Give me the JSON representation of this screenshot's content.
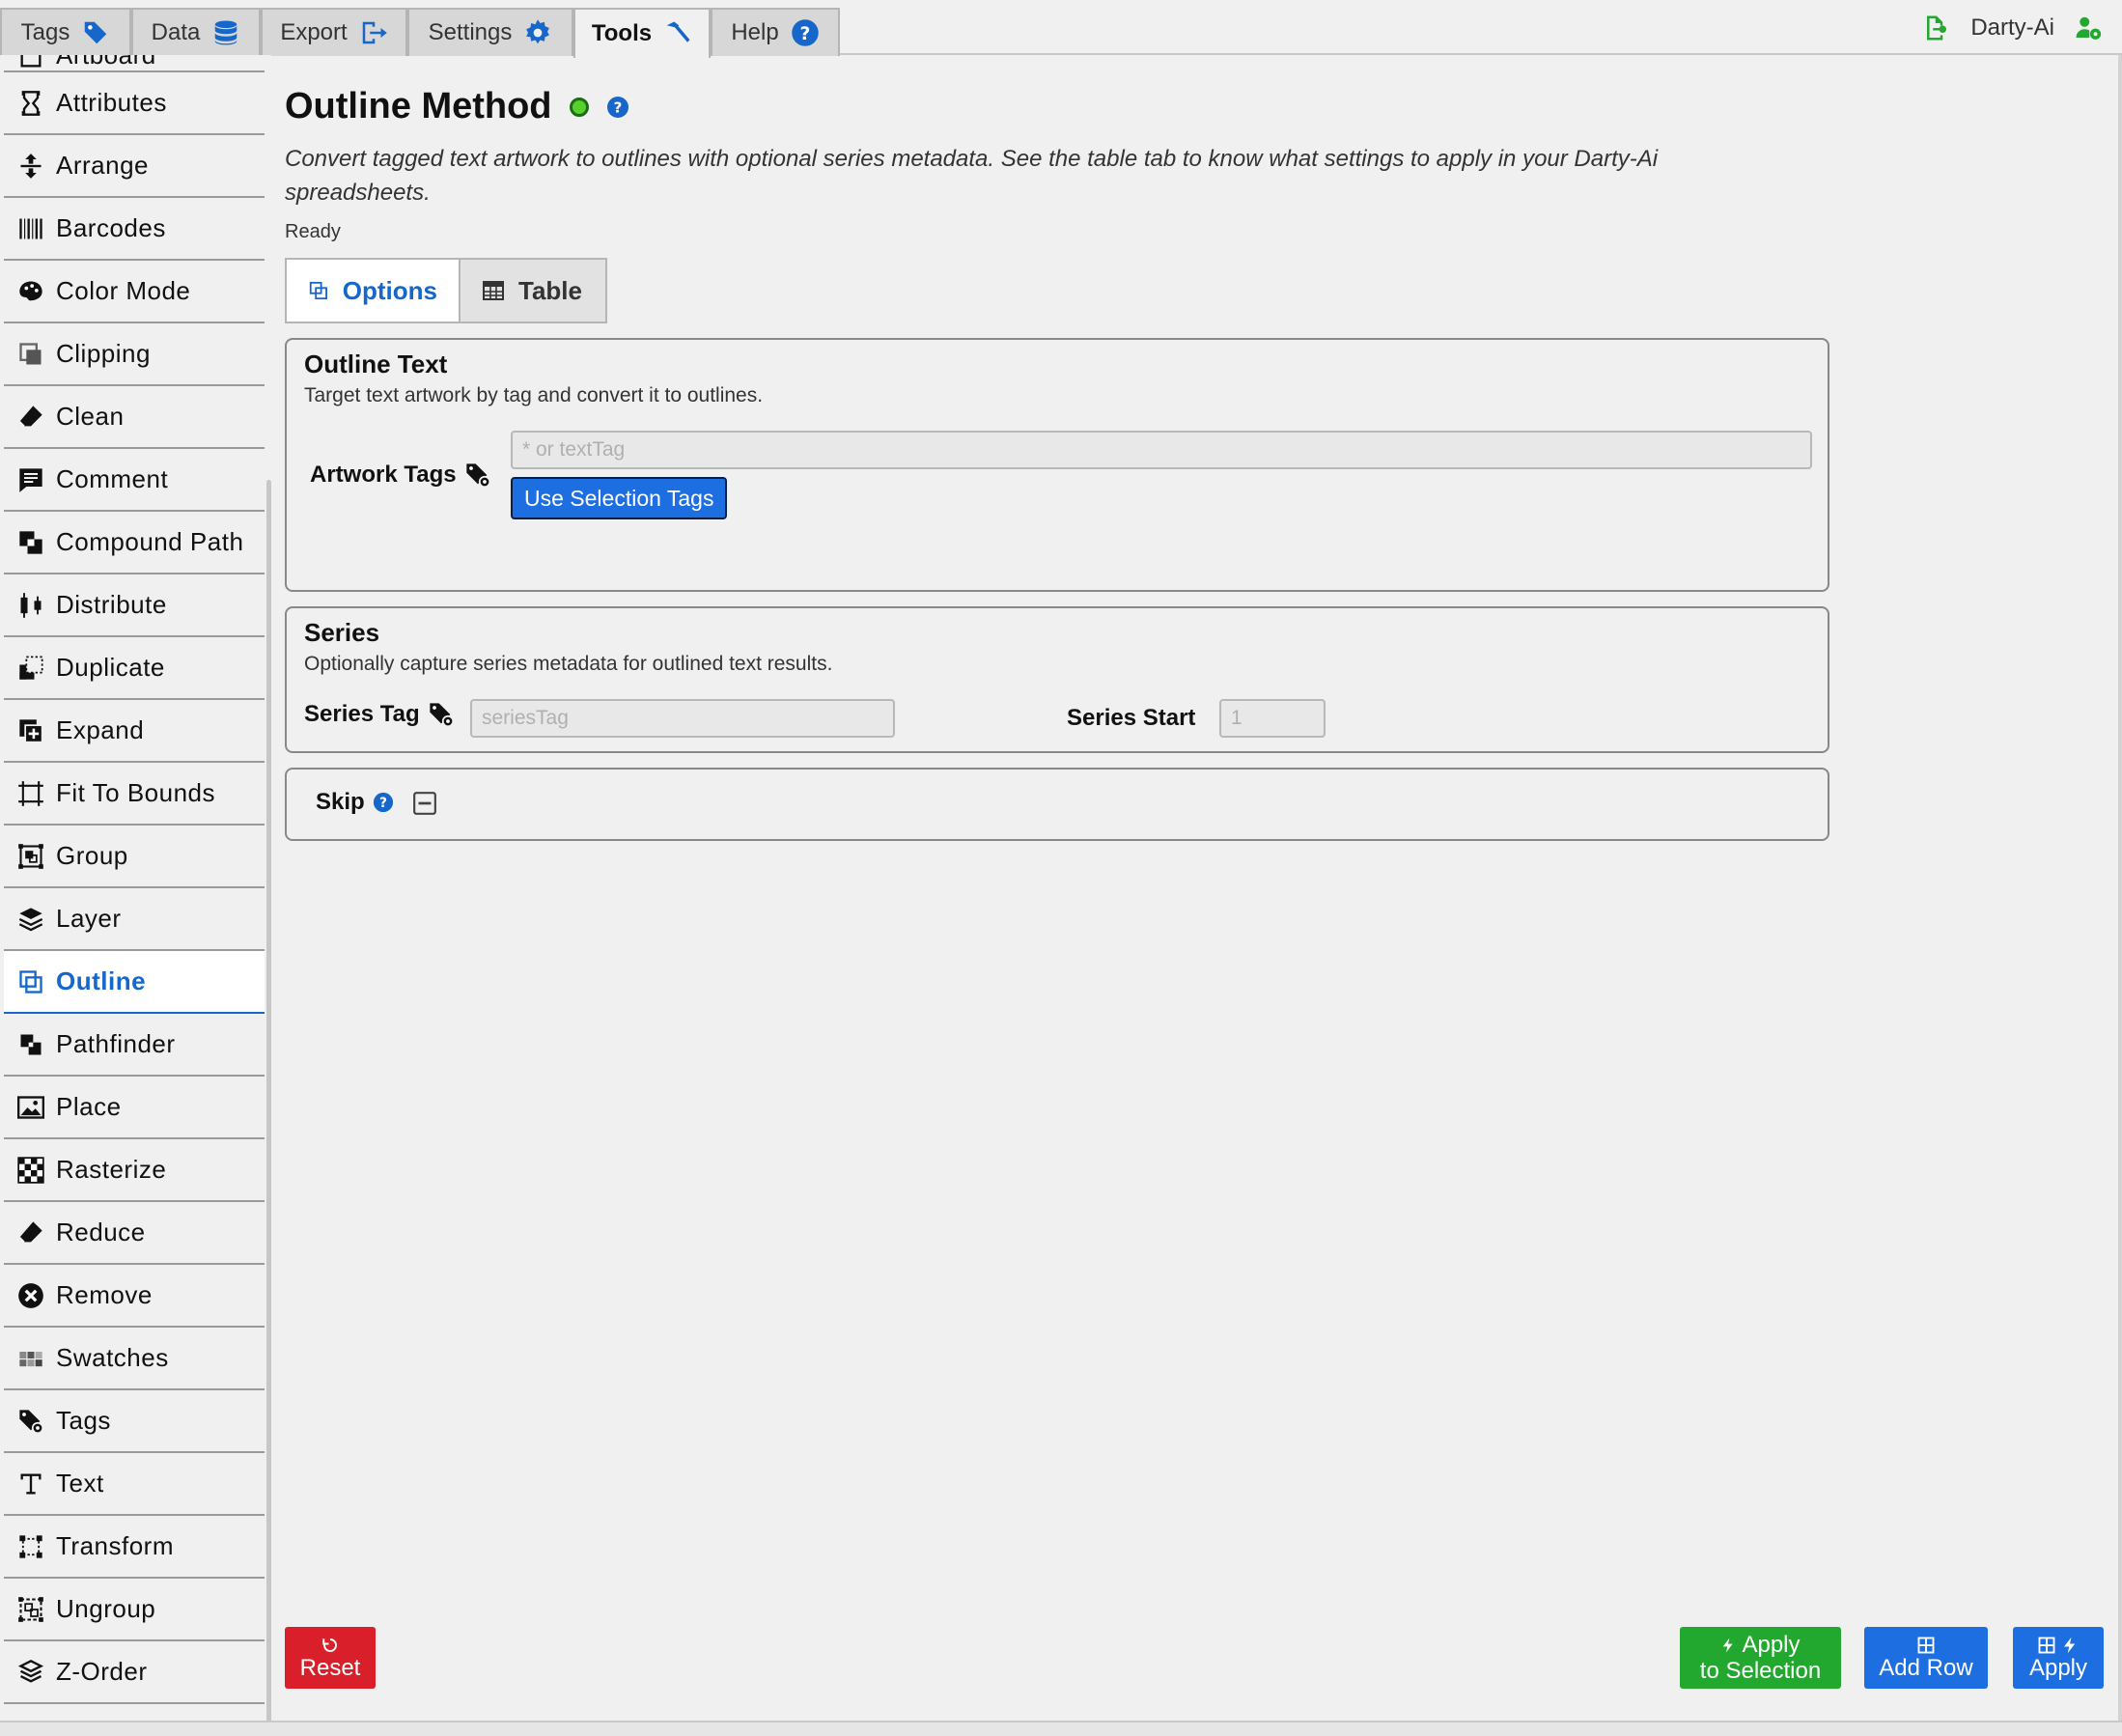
{
  "top_tabs": [
    {
      "label": "Tags",
      "icon": "tag-icon"
    },
    {
      "label": "Data",
      "icon": "database-icon"
    },
    {
      "label": "Export",
      "icon": "export-icon"
    },
    {
      "label": "Settings",
      "icon": "gear-icon"
    },
    {
      "label": "Tools",
      "icon": "hammer-icon",
      "active": true
    },
    {
      "label": "Help",
      "icon": "help-icon"
    }
  ],
  "brand": {
    "name": "Darty-Ai"
  },
  "sidebar": {
    "items": [
      {
        "label": "Artboard"
      },
      {
        "label": "Attributes"
      },
      {
        "label": "Arrange"
      },
      {
        "label": "Barcodes"
      },
      {
        "label": "Color Mode"
      },
      {
        "label": "Clipping"
      },
      {
        "label": "Clean"
      },
      {
        "label": "Comment"
      },
      {
        "label": "Compound Path"
      },
      {
        "label": "Distribute"
      },
      {
        "label": "Duplicate"
      },
      {
        "label": "Expand"
      },
      {
        "label": "Fit To Bounds"
      },
      {
        "label": "Group"
      },
      {
        "label": "Layer"
      },
      {
        "label": "Outline",
        "active": true
      },
      {
        "label": "Pathfinder"
      },
      {
        "label": "Place"
      },
      {
        "label": "Rasterize"
      },
      {
        "label": "Reduce"
      },
      {
        "label": "Remove"
      },
      {
        "label": "Swatches"
      },
      {
        "label": "Tags"
      },
      {
        "label": "Text"
      },
      {
        "label": "Transform"
      },
      {
        "label": "Ungroup"
      },
      {
        "label": "Z-Order"
      }
    ]
  },
  "main": {
    "title": "Outline Method",
    "description": "Convert tagged text artwork to outlines with optional series metadata. See the table tab to know what settings to apply in your Darty-Ai spreadsheets.",
    "status": "Ready",
    "tabs": [
      {
        "label": "Options",
        "active": true
      },
      {
        "label": "Table"
      }
    ],
    "outline_text": {
      "title": "Outline Text",
      "description": "Target text artwork by tag and convert it to outlines.",
      "artwork_tags_label": "Artwork Tags",
      "artwork_tags_placeholder": "* or textTag",
      "artwork_tags_value": "",
      "use_selection_label": "Use Selection Tags"
    },
    "series": {
      "title": "Series",
      "description": "Optionally capture series metadata for outlined text results.",
      "series_tag_label": "Series Tag",
      "series_tag_placeholder": "seriesTag",
      "series_start_label": "Series Start",
      "series_start_placeholder": "1"
    },
    "skip": {
      "title": "Skip"
    }
  },
  "actions": {
    "reset_label": "Reset",
    "apply_selection_label_1": "Apply",
    "apply_selection_label_2": "to Selection",
    "add_row_label": "Add Row",
    "apply_label": "Apply"
  },
  "colors": {
    "accent": "#1667c9",
    "primary_button": "#1d6ee0",
    "reset": "#d9202a",
    "apply_selection": "#22a82e",
    "status_ok": "#56d12c"
  }
}
